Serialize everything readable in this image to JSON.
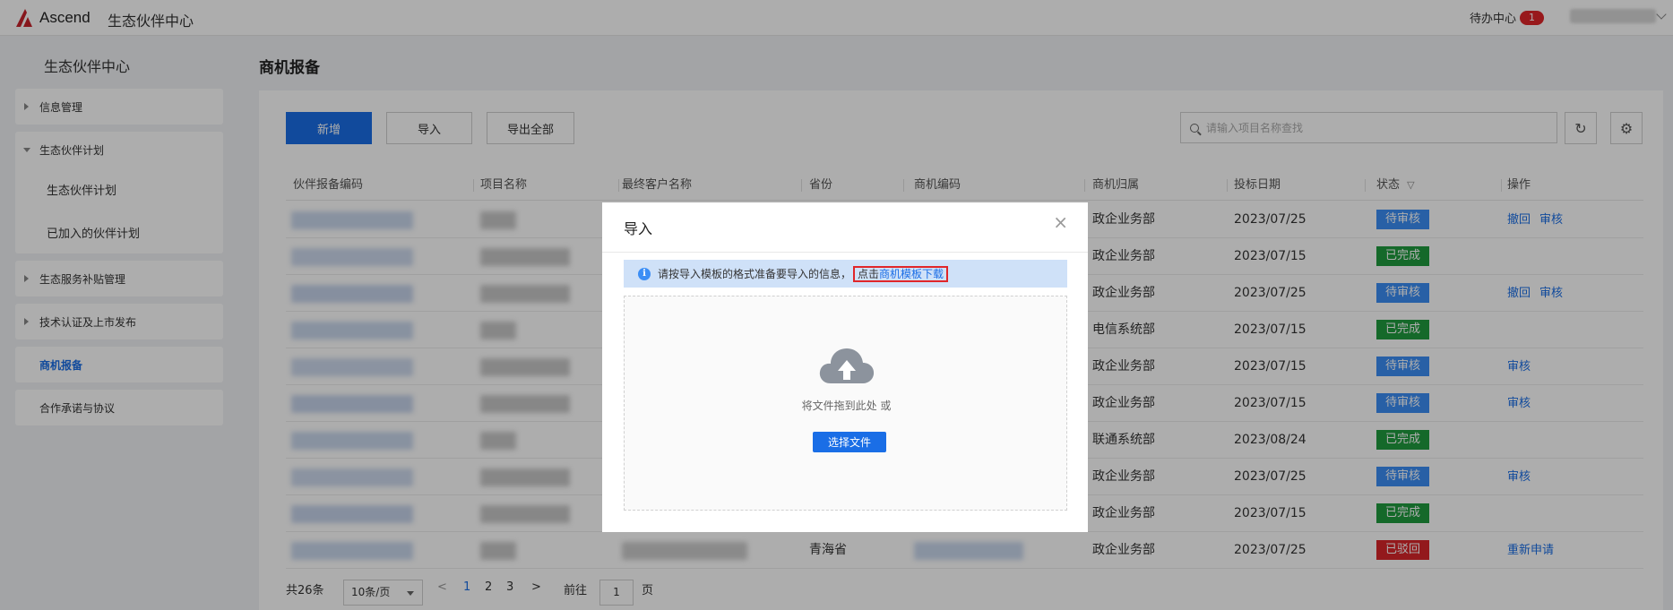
{
  "header": {
    "logo_text": "Ascend",
    "app_title": "生态伙伴中心",
    "todo_label": "待办中心",
    "todo_count": "1"
  },
  "sidebar": {
    "title": "生态伙伴中心",
    "items": [
      {
        "label": "信息管理"
      },
      {
        "label": "生态伙伴计划"
      },
      {
        "label": "生态伙伴计划"
      },
      {
        "label": "已加入的伙伴计划"
      },
      {
        "label": "生态服务补贴管理"
      },
      {
        "label": "技术认证及上市发布"
      },
      {
        "label": "商机报备"
      },
      {
        "label": "合作承诺与协议"
      }
    ]
  },
  "main": {
    "page_title": "商机报备",
    "toolbar": {
      "add_label": "新增",
      "import_label": "导入",
      "export_label": "导出全部",
      "search_placeholder": "请输入项目名称查找"
    },
    "columns": [
      "伙伴报备编码",
      "项目名称",
      "最终客户名称",
      "省份",
      "商机编码",
      "商机归属",
      "投标日期",
      "状态",
      "操作"
    ],
    "rows": [
      {
        "dept": "政企业务部",
        "date": "2023/07/25",
        "status": "待审核",
        "status_type": "pending",
        "ops": [
          "撤回",
          "审核"
        ]
      },
      {
        "dept": "政企业务部",
        "date": "2023/07/15",
        "status": "已完成",
        "status_type": "done",
        "ops": []
      },
      {
        "dept": "政企业务部",
        "date": "2023/07/25",
        "status": "待审核",
        "status_type": "pending",
        "ops": [
          "撤回",
          "审核"
        ]
      },
      {
        "dept": "电信系统部",
        "date": "2023/07/15",
        "status": "已完成",
        "status_type": "done",
        "ops": []
      },
      {
        "dept": "政企业务部",
        "date": "2023/07/15",
        "status": "待审核",
        "status_type": "pending",
        "ops": [
          "审核"
        ]
      },
      {
        "dept": "政企业务部",
        "date": "2023/07/15",
        "status": "待审核",
        "status_type": "pending",
        "ops": [
          "审核"
        ]
      },
      {
        "dept": "联通系统部",
        "date": "2023/08/24",
        "status": "已完成",
        "status_type": "done",
        "ops": []
      },
      {
        "dept": "政企业务部",
        "date": "2023/07/25",
        "status": "待审核",
        "status_type": "pending",
        "ops": [
          "审核"
        ]
      },
      {
        "dept": "政企业务部",
        "date": "2023/07/15",
        "status": "已完成",
        "status_type": "done",
        "ops": []
      },
      {
        "province": "青海省",
        "dept": "政企业务部",
        "date": "2023/07/25",
        "status": "已驳回",
        "status_type": "rejected",
        "ops": [
          "重新申请"
        ]
      }
    ],
    "pagination": {
      "total": "共26条",
      "page_size": "10条/页",
      "pages": [
        "1",
        "2",
        "3"
      ],
      "goto_label": "前往",
      "goto_value": "1",
      "page_suffix": "页",
      "prev": "<",
      "next": ">"
    }
  },
  "modal": {
    "title": "导入",
    "close": "×",
    "alert_text": "请按导入模板的格式准备要导入的信息，",
    "alert_click": "点击",
    "alert_link": "商机模板下载",
    "drop_text": "将文件拖到此处 或",
    "choose_file": "选择文件"
  },
  "colors": {
    "primary": "#1a6ee6",
    "pending": "#3c8ef5",
    "done": "#1f9b3e",
    "rejected": "#d9262a",
    "badge": "#e0262a"
  }
}
